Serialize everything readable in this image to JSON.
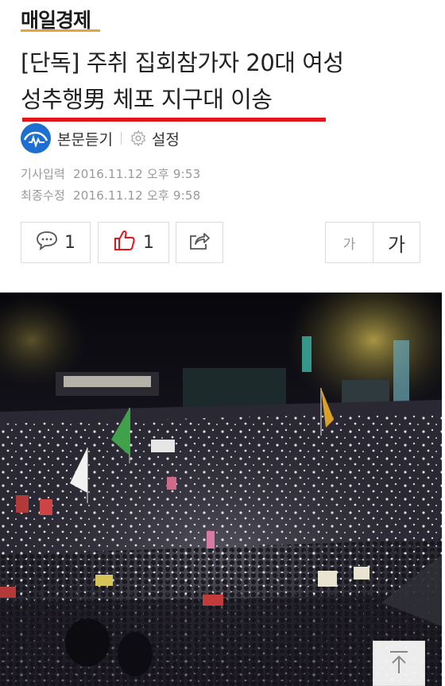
{
  "brand": {
    "name": "매일경제"
  },
  "article": {
    "headline_line1": "[단독] 주취 집회참가자 20대 여성",
    "headline_line2": "성추행男 체포 지구대 이송",
    "listen_label": "본문듣기",
    "settings_label": "설정",
    "input_label": "기사입력",
    "input_time": "2016.11.12 오후 9:53",
    "modified_label": "최종수정",
    "modified_time": "2016.11.12 오후 9:58"
  },
  "actions": {
    "comment_count": "1",
    "like_count": "1",
    "font_small": "가",
    "font_large": "가"
  },
  "colors": {
    "brand_underline": "#e8a33d",
    "headline_rule": "#e3151a",
    "like_icon": "#e3151a",
    "listen_icon_bg": "#1d6fd1"
  },
  "icons": [
    "listen-icon",
    "gear-icon",
    "comment-icon",
    "thumbs-up-icon",
    "share-icon",
    "arrow-up-icon"
  ]
}
